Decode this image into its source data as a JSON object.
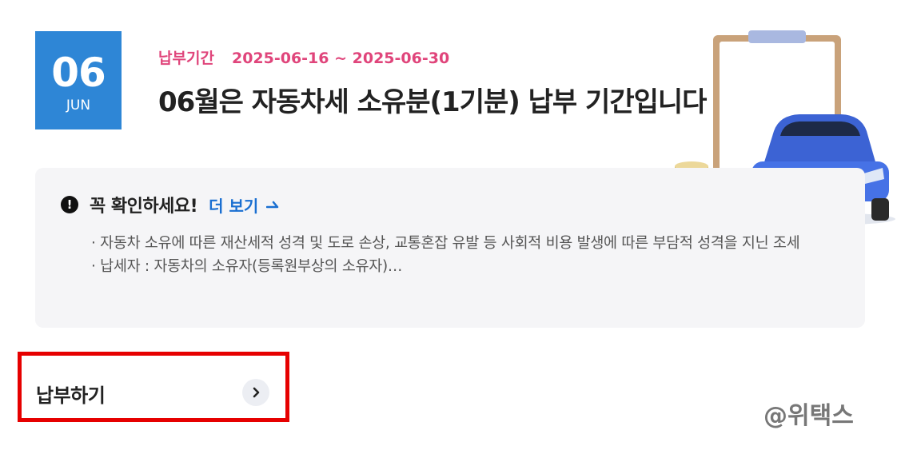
{
  "calendar": {
    "day": "06",
    "month": "JUN",
    "color": "#2e86d6"
  },
  "period": {
    "label": "납부기간",
    "range": "2025-06-16 ~ 2025-06-30",
    "color": "#e0457b"
  },
  "headline": "06월은 자동차세 소유분(1기분) 납부 기간입니다",
  "notice": {
    "icon": "exclamation-circle-icon",
    "title": "꼭 확인하세요!",
    "more_link": "더 보기",
    "more_icon": "arrow-right-icon",
    "lines": [
      "· 자동차 소유에 따른 재산세적 성격 및 도로 손상, 교통혼잡 유발 등 사회적 비용 발생에 따른 부담적 성격을 지닌 조세",
      "· 납세자 : 자동차의 소유자(등록원부상의 소유자)…"
    ]
  },
  "pay_button": {
    "label": "납부하기",
    "icon": "chevron-right-icon",
    "highlight_color": "#e60000"
  },
  "illustration": {
    "icons": [
      "clipboard-icon",
      "coin-stack-icon",
      "car-icon"
    ]
  },
  "watermark": "@위택스"
}
